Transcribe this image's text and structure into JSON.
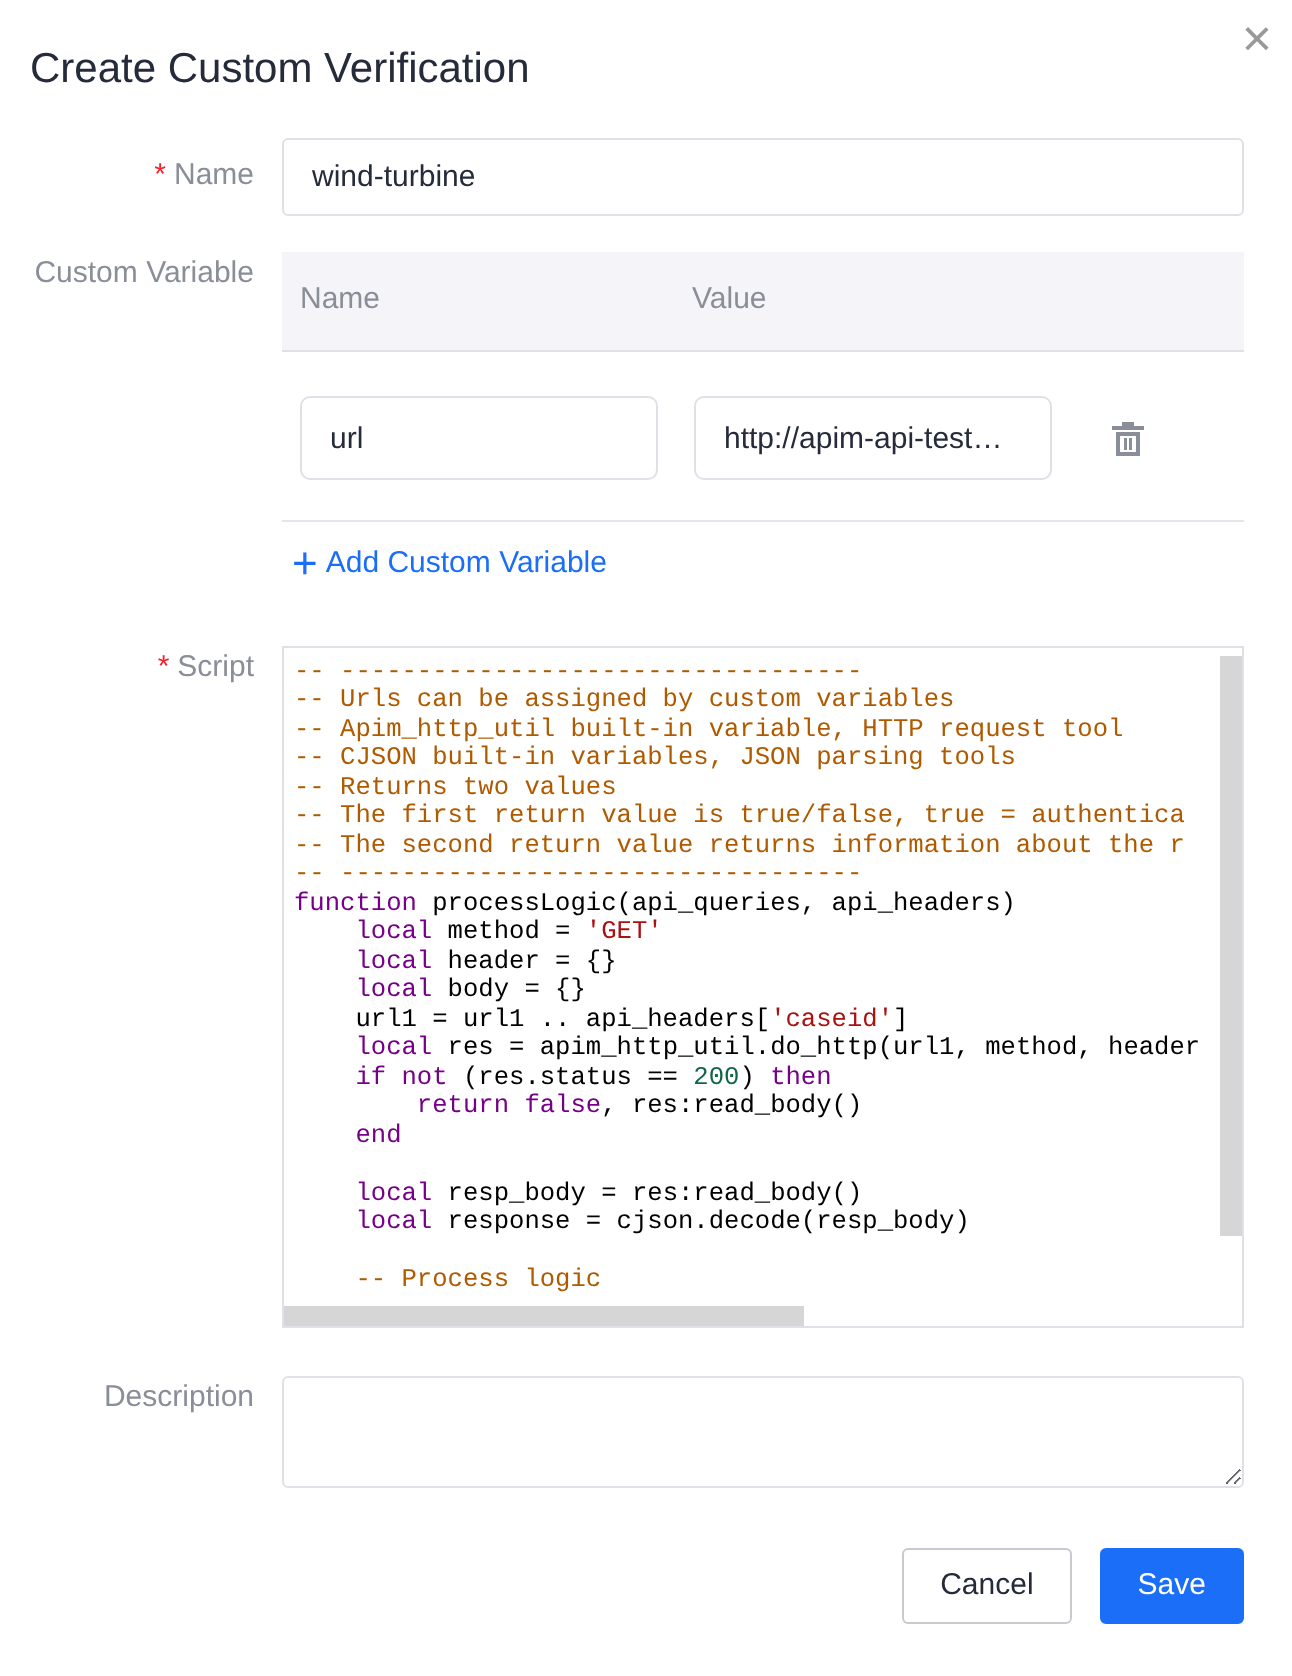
{
  "dialog": {
    "title": "Create Custom Verification",
    "close": "×"
  },
  "required_mark": "*",
  "name_field": {
    "label": "Name",
    "required": true,
    "value": "wind-turbine"
  },
  "custom_variable": {
    "label": "Custom Variable",
    "columns": [
      "Name",
      "Value"
    ],
    "rows": [
      {
        "name": "url",
        "value": "http://apim-api-test…"
      }
    ],
    "add_link": {
      "icon": "+",
      "label": "Add Custom Variable"
    }
  },
  "script": {
    "label": "Script",
    "required": true,
    "lines": [
      {
        "kind": "code",
        "tokens": [
          {
            "kind": "comment",
            "text": "-- ----------------------------------"
          }
        ]
      },
      {
        "kind": "code",
        "tokens": [
          {
            "kind": "comment",
            "text": "-- Urls can be assigned by custom variables"
          }
        ]
      },
      {
        "kind": "code",
        "tokens": [
          {
            "kind": "comment",
            "text": "-- Apim_http_util built-in variable, HTTP request tool"
          }
        ]
      },
      {
        "kind": "code",
        "tokens": [
          {
            "kind": "comment",
            "text": "-- CJSON built-in variables, JSON parsing tools"
          }
        ]
      },
      {
        "kind": "code",
        "tokens": [
          {
            "kind": "comment",
            "text": "-- Returns two values"
          }
        ]
      },
      {
        "kind": "code",
        "tokens": [
          {
            "kind": "comment",
            "text": "-- The first return value is true/false, true = authentica"
          }
        ]
      },
      {
        "kind": "code",
        "tokens": [
          {
            "kind": "comment",
            "text": "-- The second return value returns information about the r"
          }
        ]
      },
      {
        "kind": "code",
        "tokens": [
          {
            "kind": "comment",
            "text": "-- ----------------------------------"
          }
        ]
      },
      {
        "kind": "code",
        "tokens": [
          {
            "kind": "keyword",
            "text": "function"
          },
          {
            "kind": "plain",
            "text": " processLogic(api_queries, api_headers)"
          }
        ]
      },
      {
        "kind": "code",
        "tokens": [
          {
            "kind": "keyword",
            "text": "    local"
          },
          {
            "kind": "plain",
            "text": " method = "
          },
          {
            "kind": "string",
            "text": "'GET'"
          }
        ]
      },
      {
        "kind": "code",
        "tokens": [
          {
            "kind": "keyword",
            "text": "    local"
          },
          {
            "kind": "plain",
            "text": " header = {}"
          }
        ]
      },
      {
        "kind": "code",
        "tokens": [
          {
            "kind": "keyword",
            "text": "    local"
          },
          {
            "kind": "plain",
            "text": " body = {}"
          }
        ]
      },
      {
        "kind": "code",
        "tokens": [
          {
            "kind": "plain",
            "text": "    url1 = url1 .. api_headers["
          },
          {
            "kind": "string",
            "text": "'caseid'"
          },
          {
            "kind": "plain",
            "text": "]"
          }
        ]
      },
      {
        "kind": "code",
        "tokens": [
          {
            "kind": "keyword",
            "text": "    local"
          },
          {
            "kind": "plain",
            "text": " res = apim_http_util.do_http(url1, method, header"
          }
        ]
      },
      {
        "kind": "code",
        "tokens": [
          {
            "kind": "keyword",
            "text": "    if not"
          },
          {
            "kind": "plain",
            "text": " (res.status == "
          },
          {
            "kind": "number",
            "text": "200"
          },
          {
            "kind": "plain",
            "text": ") "
          },
          {
            "kind": "keyword",
            "text": "then"
          }
        ]
      },
      {
        "kind": "code",
        "tokens": [
          {
            "kind": "keyword",
            "text": "        return false"
          },
          {
            "kind": "plain",
            "text": ", res:read_body()"
          }
        ]
      },
      {
        "kind": "code",
        "tokens": [
          {
            "kind": "keyword",
            "text": "    end"
          }
        ]
      },
      {
        "kind": "blank"
      },
      {
        "kind": "code",
        "tokens": [
          {
            "kind": "keyword",
            "text": "    local"
          },
          {
            "kind": "plain",
            "text": " resp_body = res:read_body()"
          }
        ]
      },
      {
        "kind": "code",
        "tokens": [
          {
            "kind": "keyword",
            "text": "    local"
          },
          {
            "kind": "plain",
            "text": " response = cjson.decode(resp_body)"
          }
        ]
      },
      {
        "kind": "blank"
      },
      {
        "kind": "code",
        "tokens": [
          {
            "kind": "comment",
            "text": "    -- Process logic"
          }
        ]
      }
    ]
  },
  "description": {
    "label": "Description",
    "required": false
  },
  "buttons": [
    {
      "label": "Cancel",
      "kind": "secondary"
    },
    {
      "label": "Save",
      "kind": "primary"
    }
  ]
}
